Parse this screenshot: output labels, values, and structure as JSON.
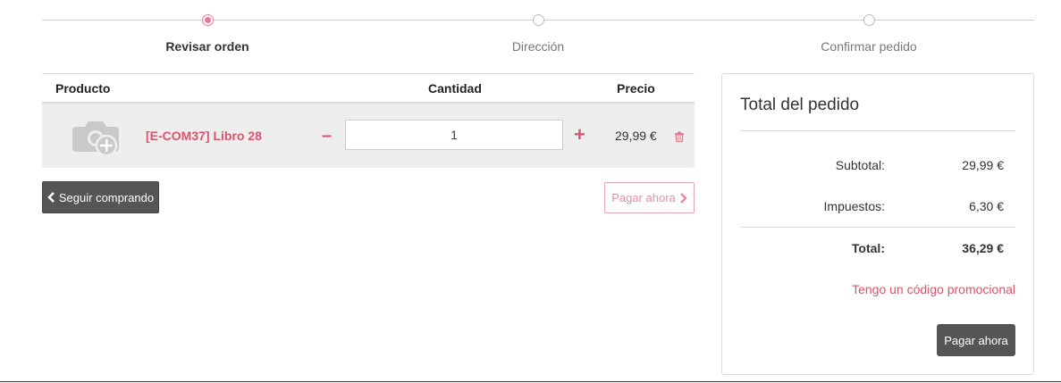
{
  "wizard": {
    "steps": [
      {
        "label": "Revisar orden",
        "active": true
      },
      {
        "label": "Dirección",
        "active": false
      },
      {
        "label": "Confirmar pedido",
        "active": false
      }
    ]
  },
  "cart": {
    "headers": {
      "product": "Producto",
      "quantity": "Cantidad",
      "price": "Precio"
    },
    "items": [
      {
        "name": "[E-COM37] Libro 28",
        "quantity": "1",
        "price": "29,99 €",
        "image_icon": "camera-add-icon"
      }
    ],
    "continue_label": "Seguir comprando",
    "pay_label": "Pagar ahora"
  },
  "summary": {
    "title": "Total del pedido",
    "subtotal_label": "Subtotal:",
    "subtotal_value": "29,99 €",
    "taxes_label": "Impuestos:",
    "taxes_value": "6,30 €",
    "total_label": "Total:",
    "total_value": "36,29 €",
    "promo_label": "Tengo un código promocional",
    "pay_label": "Pagar ahora"
  },
  "colors": {
    "accent": "#d9546a",
    "dark_button": "#555555"
  }
}
